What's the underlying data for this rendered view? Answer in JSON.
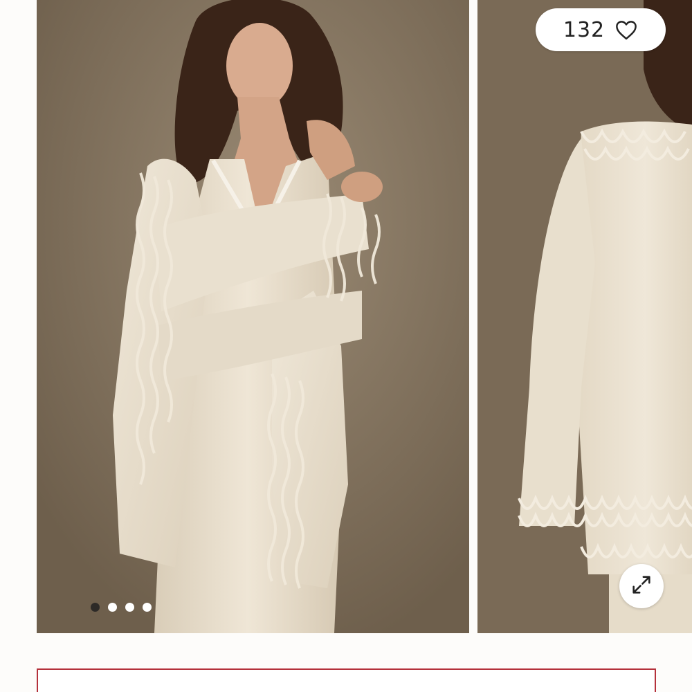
{
  "gallery": {
    "like_count": "132",
    "icons": {
      "like": "heart-icon",
      "expand": "expand-arrows-icon"
    },
    "pagination": {
      "total": 4,
      "active_index": 0
    },
    "slides": [
      {
        "name": "model-front-view",
        "description_icon": "photo"
      },
      {
        "name": "cardigan-back-view",
        "description_icon": "photo"
      }
    ]
  },
  "colors": {
    "backdrop": "#7f6f5b",
    "garment": "#ebe2d2",
    "accent_border": "#b4313b",
    "dot_active": "#2d2a27"
  }
}
